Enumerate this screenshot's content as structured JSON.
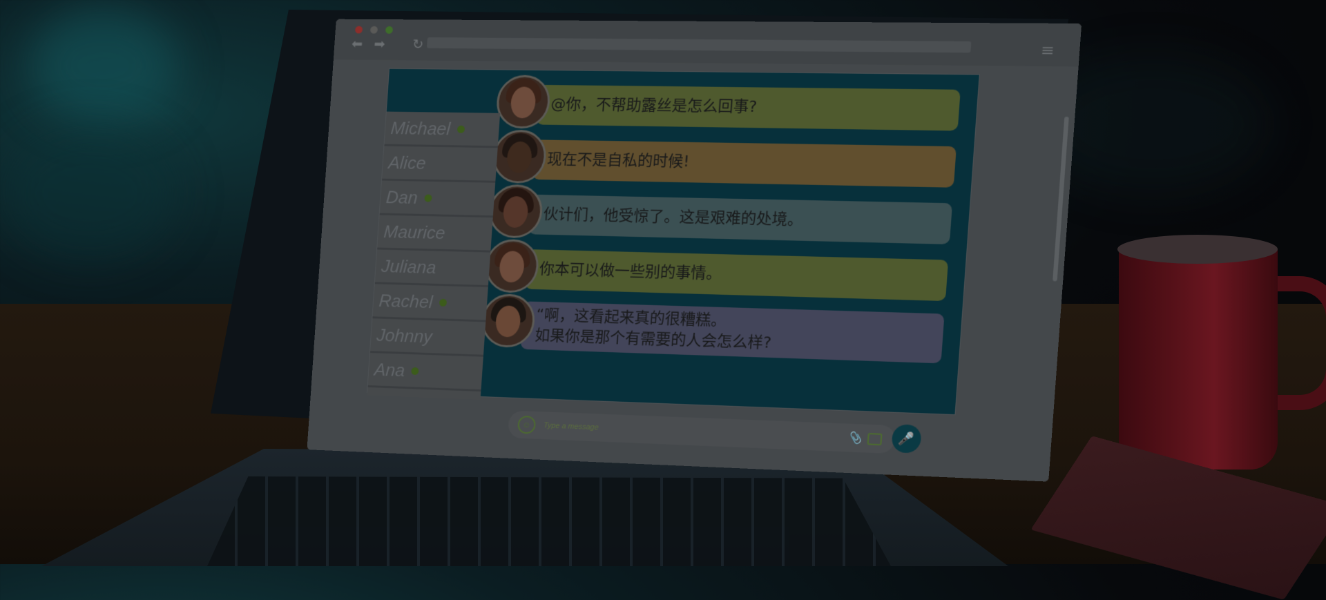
{
  "browser": {
    "nav_back": "⬅",
    "nav_forward": "➡",
    "reload": "↻",
    "menu": "≡"
  },
  "contacts": [
    {
      "name": "Michael",
      "online": true
    },
    {
      "name": "Alice",
      "online": false
    },
    {
      "name": "Dan",
      "online": true
    },
    {
      "name": "Maurice",
      "online": false
    },
    {
      "name": "Juliana",
      "online": false
    },
    {
      "name": "Rachel",
      "online": true
    },
    {
      "name": "Johnny",
      "online": false
    },
    {
      "name": "Ana",
      "online": true
    }
  ],
  "messages": [
    {
      "text": "@你，不帮助露丝是怎么回事?",
      "color": "#7fa04a"
    },
    {
      "text": "现在不是自私的时候!",
      "color": "#e0a54e"
    },
    {
      "text": "伙计们，他受惊了。这是艰难的处境。",
      "color": "#7fb3b8"
    },
    {
      "text": "你本可以做一些别的事情。",
      "color": "#7fa04a"
    },
    {
      "text": "“啊，这看起来真的很糟糕。\n如果你是那个有需要的人会怎么样?",
      "color": "#8f93c9"
    }
  ],
  "composer": {
    "placeholder": "Type a message",
    "emoji_icon": "☺",
    "attach_icon": "📎",
    "mic_icon": "🎤"
  },
  "colors": {
    "chat_panel": "#0b8fa6",
    "online_dot": "#7ab83a"
  }
}
